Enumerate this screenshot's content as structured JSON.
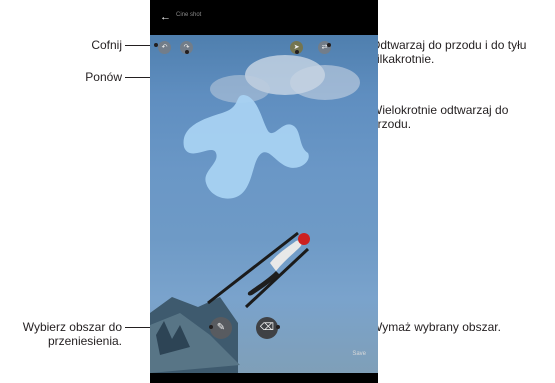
{
  "annotations": {
    "undo": "Cofnij",
    "redo": "Ponów",
    "loop_label_line1": "Odtwarzaj do przodu i do tyłu",
    "loop_label_line2": "kilkakrotnie.",
    "repeat_label_line1": "Wielokrotnie odtwarzaj do",
    "repeat_label_line2": "przodu.",
    "select_area_line1": "Wybierz obszar do",
    "select_area_line2": "przeniesienia.",
    "erase_area": "Wymaż wybrany obszar."
  },
  "phone": {
    "back_icon": "arrow-left-icon",
    "title": "Cine shot",
    "save_label": "Save"
  },
  "colors": {
    "brush": "#a8d2f2",
    "sky": "#6a97c6",
    "annotation_text": "#231f20"
  }
}
